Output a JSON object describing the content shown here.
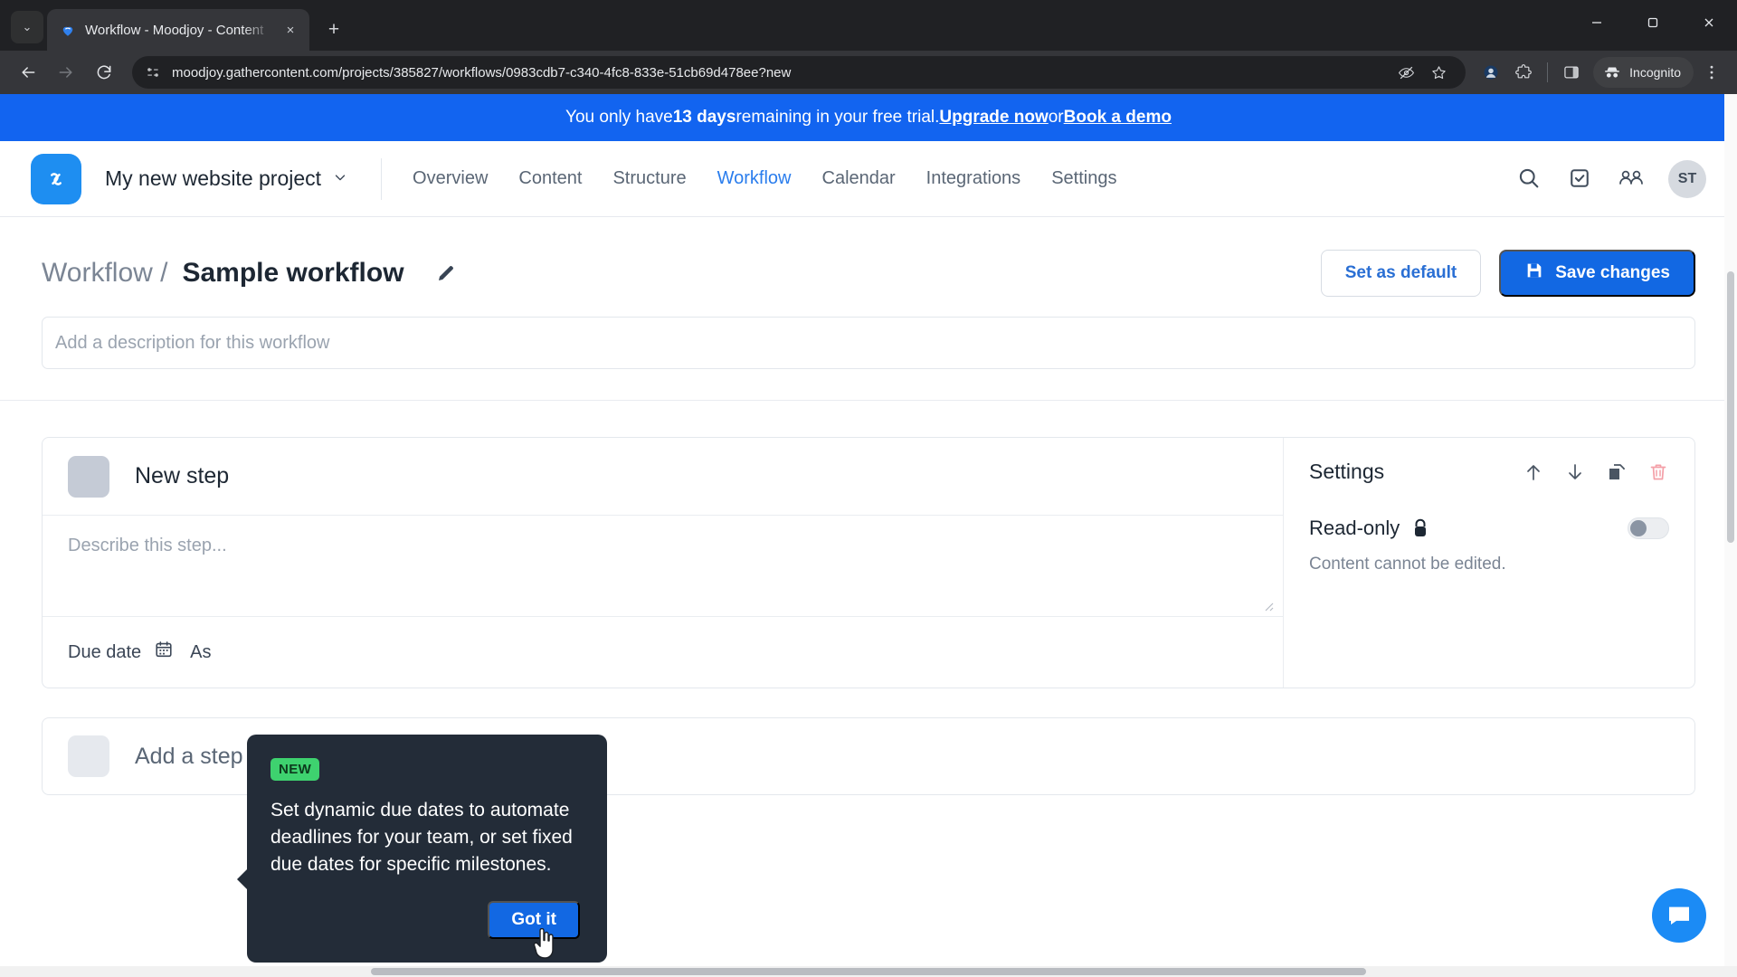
{
  "browser": {
    "tab": {
      "title": "Workflow - Moodjoy - Content",
      "favicon_name": "gathercontent-favicon",
      "close_label": "×"
    },
    "new_tab_label": "+",
    "tab_search_label": "⌄",
    "window_controls": {
      "minimize": "—",
      "maximize": "❐",
      "close": "✕"
    },
    "nav": {
      "back": "←",
      "forward": "→",
      "reload": "↻"
    },
    "omnibox": {
      "url": "moodjoy.gathercontent.com/projects/385827/workflows/0983cdb7-c340-4fc8-833e-51cb69d478ee?new",
      "site_info_icon": "page-info-icon",
      "tracking_icon": "eye-slash-icon",
      "bookmark_icon": "star-icon"
    },
    "actions": {
      "extension_icon": "extension-puzzle-icon",
      "profile_icon": "profile-avatar-icon",
      "side_panel_icon": "side-panel-icon",
      "menu_icon": "three-dot-menu-icon",
      "incognito_label": "Incognito"
    }
  },
  "banner": {
    "prefix": "You only have ",
    "days": "13 days",
    "middle": " remaining in your free trial. ",
    "upgrade_link": "Upgrade now",
    "or": " or ",
    "demo_link": "Book a demo"
  },
  "appbar": {
    "logo_name": "gathercontent-logo",
    "project_name": "My new website project",
    "project_chevron": "⌄",
    "nav_items": [
      {
        "label": "Overview",
        "active": false
      },
      {
        "label": "Content",
        "active": false
      },
      {
        "label": "Structure",
        "active": false
      },
      {
        "label": "Workflow",
        "active": true
      },
      {
        "label": "Calendar",
        "active": false
      },
      {
        "label": "Integrations",
        "active": false
      },
      {
        "label": "Settings",
        "active": false
      }
    ],
    "right_icons": [
      "search-icon",
      "tasks-icon",
      "people-icon"
    ],
    "avatar_initials": "ST"
  },
  "page": {
    "breadcrumb": "Workflow /",
    "title": "Sample workflow",
    "edit_icon": "pencil-icon",
    "set_default_label": "Set as default",
    "save_label": "Save changes",
    "save_icon": "floppy-disk-icon",
    "description_placeholder": "Add a description for this workflow"
  },
  "step": {
    "name": "New step",
    "description_placeholder": "Describe this step...",
    "due_date_label": "Due date",
    "due_date_icon": "calendar-icon",
    "assignee_label": "As",
    "settings": {
      "title": "Settings",
      "move_up_icon": "arrow-up-icon",
      "move_down_icon": "arrow-down-icon",
      "duplicate_icon": "duplicate-icon",
      "delete_icon": "trash-icon",
      "readonly_label": "Read-only",
      "lock_icon": "lock-icon",
      "readonly_toggle_state": "off",
      "readonly_hint": "Content cannot be edited."
    }
  },
  "add_step": {
    "label": "Add a step",
    "swatch_name": "step-color-swatch"
  },
  "popover": {
    "badge": "NEW",
    "body": "Set dynamic due dates to automate deadlines for your team, or set fixed due dates for specific milestones.",
    "cta_label": "Got it"
  },
  "support": {
    "chat_icon": "intercom-chat-icon"
  },
  "colors": {
    "brand_blue": "#1268e3",
    "banner_blue": "#1264f0",
    "nav_active": "#2a7ded",
    "badge_green": "#3ed26f",
    "popover_bg": "#232c38",
    "danger": "#f4a0a8"
  }
}
